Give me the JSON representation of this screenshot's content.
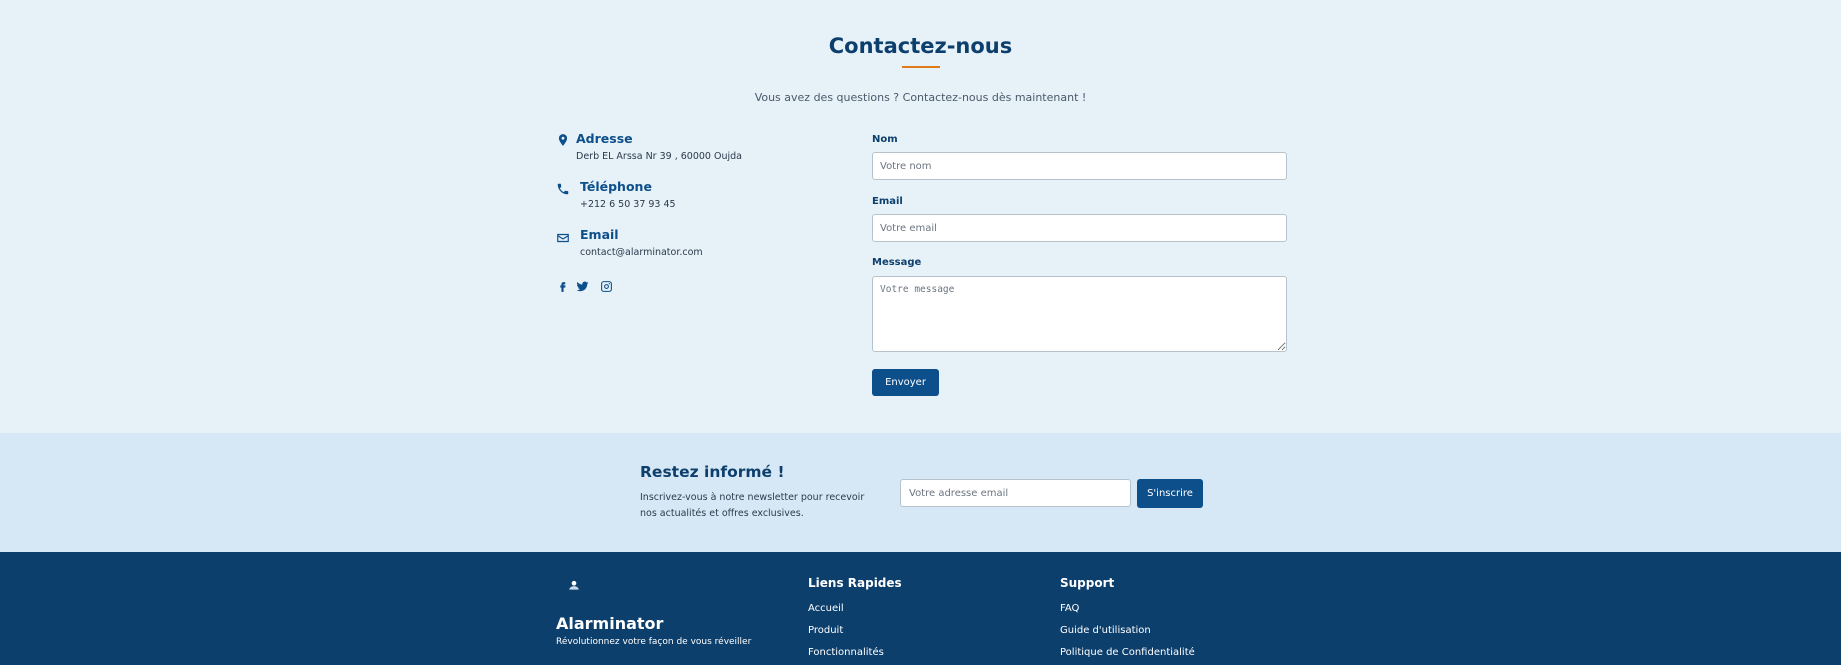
{
  "contact": {
    "title": "Contactez-nous",
    "subtitle": "Vous avez des questions ? Contactez-nous dès maintenant !",
    "info": {
      "address_label": "Adresse",
      "address_value": "Derb EL Arssa Nr 39 , 60000 Oujda",
      "phone_label": "Téléphone",
      "phone_value": "+212 6 50 37 93 45",
      "email_label": "Email",
      "email_value": "contact@alarminator.com"
    },
    "socials": [
      "facebook-icon",
      "twitter-icon",
      "instagram-icon"
    ],
    "form": {
      "name_label": "Nom",
      "name_placeholder": "Votre nom",
      "email_label": "Email",
      "email_placeholder": "Votre email",
      "message_label": "Message",
      "message_placeholder": "Votre message",
      "submit_label": "Envoyer"
    }
  },
  "newsletter": {
    "title": "Restez informé !",
    "text": "Inscrivez-vous à notre newsletter pour recevoir nos actualités et offres exclusives.",
    "input_placeholder": "Votre adresse email",
    "button_label": "S'inscrire"
  },
  "footer": {
    "brand_name": "Alarminator",
    "tagline": "Révolutionnez votre façon de vous réveiller",
    "quick_links": {
      "title": "Liens Rapides",
      "links": [
        "Accueil",
        "Produit",
        "Fonctionnalités"
      ]
    },
    "support": {
      "title": "Support",
      "links": [
        "FAQ",
        "Guide d'utilisation",
        "Politique de Confidentialité"
      ]
    }
  },
  "colors": {
    "primary": "#0d4f8b",
    "dark": "#0d3f6d",
    "accent": "#e07b1a",
    "background": "#e6f1f8"
  }
}
